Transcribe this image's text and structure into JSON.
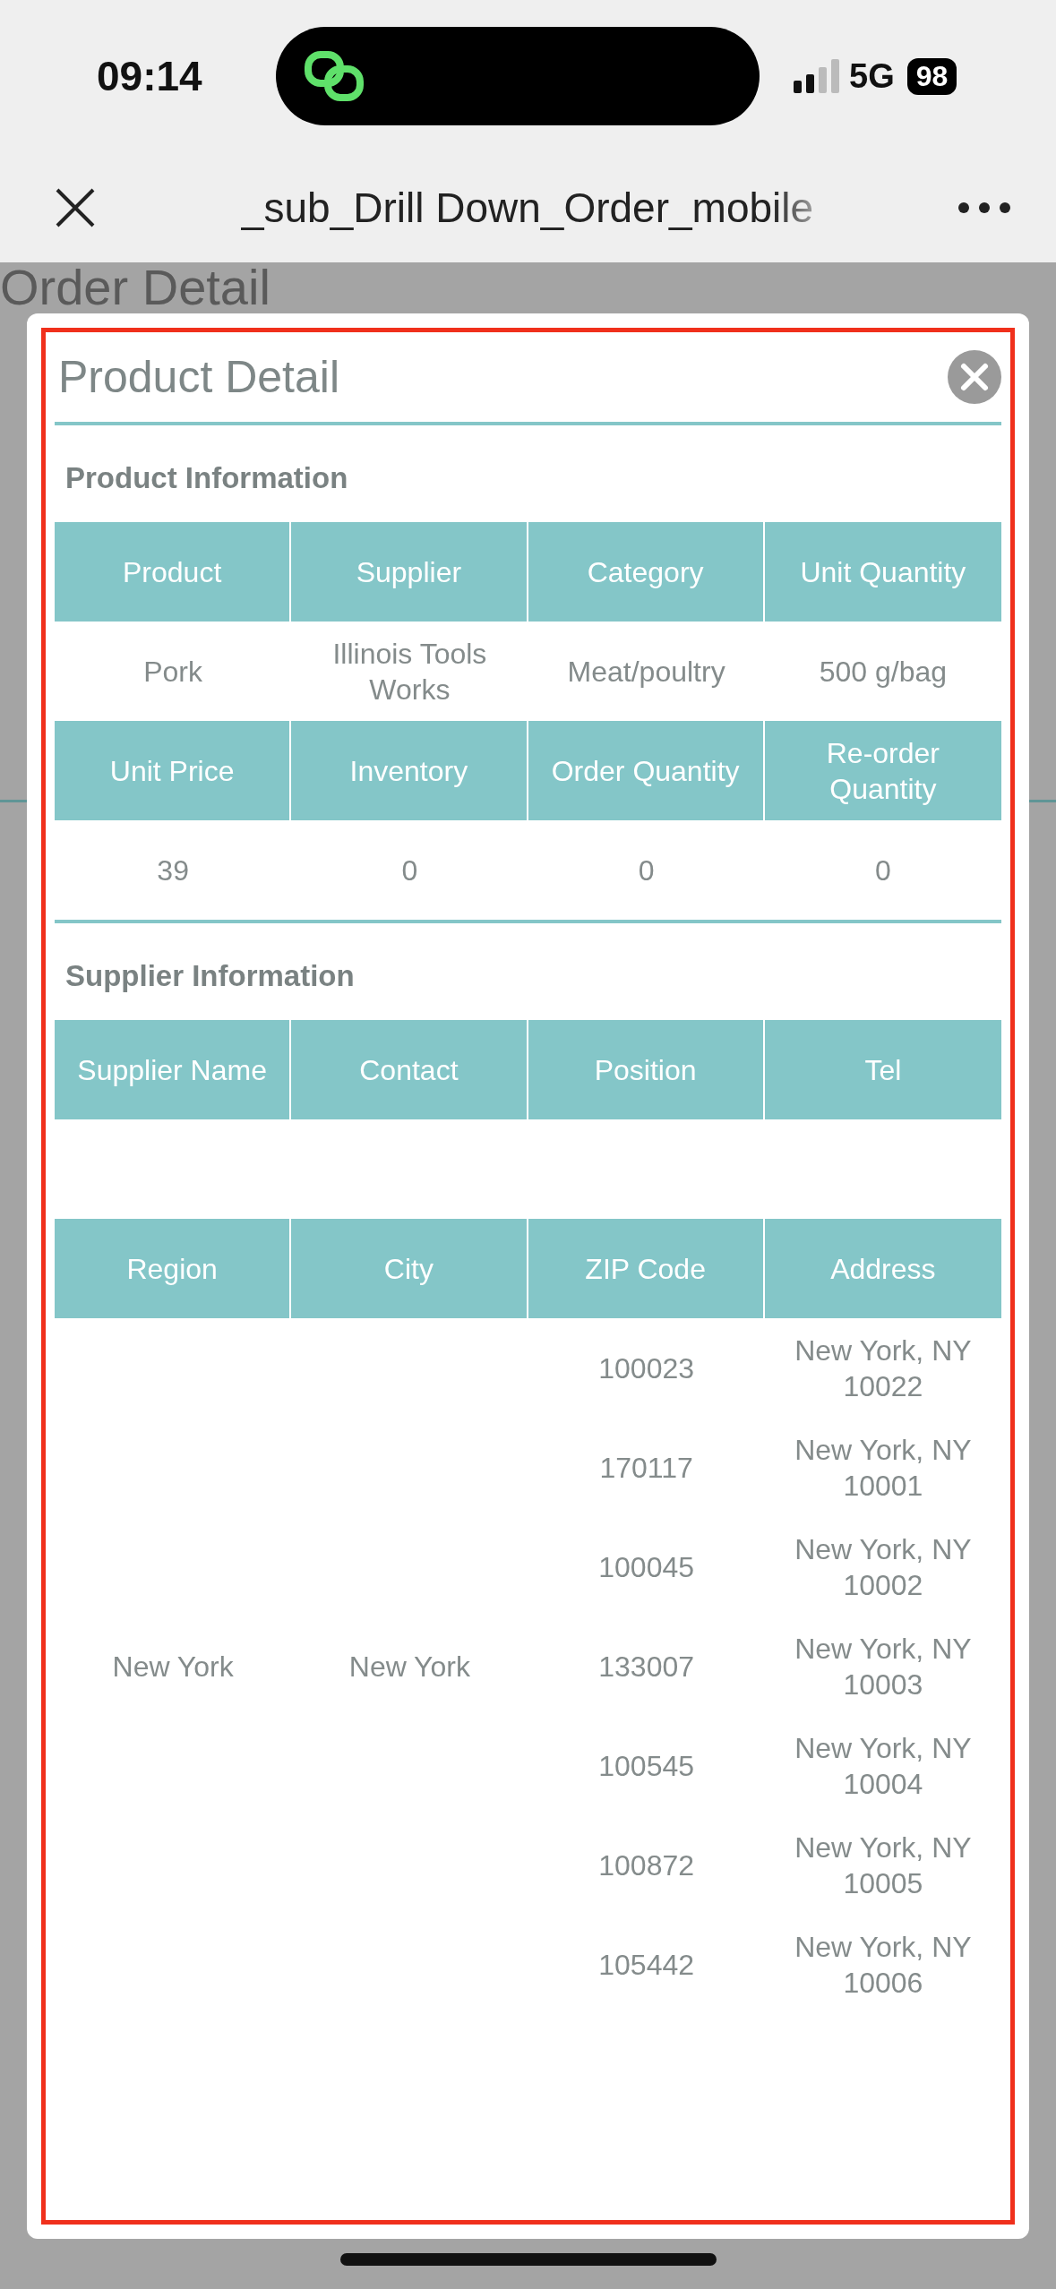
{
  "status_bar": {
    "time": "09:14",
    "network": "5G",
    "battery": "98"
  },
  "nav_bar": {
    "title": "_sub_Drill Down_Order_mobile"
  },
  "background_page": {
    "title": "Order Detail"
  },
  "dialog": {
    "title": "Product Detail",
    "sections": [
      {
        "title": "Product Information",
        "rows": [
          {
            "kind": "header",
            "cells": [
              "Product",
              "Supplier",
              "Category",
              "Unit Quantity"
            ]
          },
          {
            "kind": "data",
            "cells": [
              "Pork",
              "Illinois Tools Works",
              "Meat/poultry",
              "500 g/bag"
            ]
          },
          {
            "kind": "header",
            "cells": [
              "Unit Price",
              "Inventory",
              "Order Quantity",
              "Re-order Quantity"
            ]
          },
          {
            "kind": "data",
            "cells": [
              "39",
              "0",
              "0",
              "0"
            ]
          }
        ]
      },
      {
        "title": "Supplier Information",
        "rows": [
          {
            "kind": "header",
            "cells": [
              "Supplier Name",
              "Contact",
              "Position",
              "Tel"
            ]
          },
          {
            "kind": "blank"
          }
        ]
      }
    ],
    "address_table": {
      "columns": [
        "Region",
        "City",
        "ZIP Code",
        "Address"
      ],
      "groups": [
        {
          "region": "New York",
          "city": "New York",
          "entries": [
            {
              "zip": "100023",
              "address": "New York, NY 10022"
            },
            {
              "zip": "170117",
              "address": "New York, NY 10001"
            },
            {
              "zip": "100045",
              "address": "New York, NY 10002"
            },
            {
              "zip": "133007",
              "address": "New York, NY 10003"
            },
            {
              "zip": "100545",
              "address": "New York, NY 10004"
            },
            {
              "zip": "100872",
              "address": "New York, NY 10005"
            },
            {
              "zip": "105442",
              "address": "New York, NY 10006"
            }
          ]
        }
      ]
    }
  }
}
